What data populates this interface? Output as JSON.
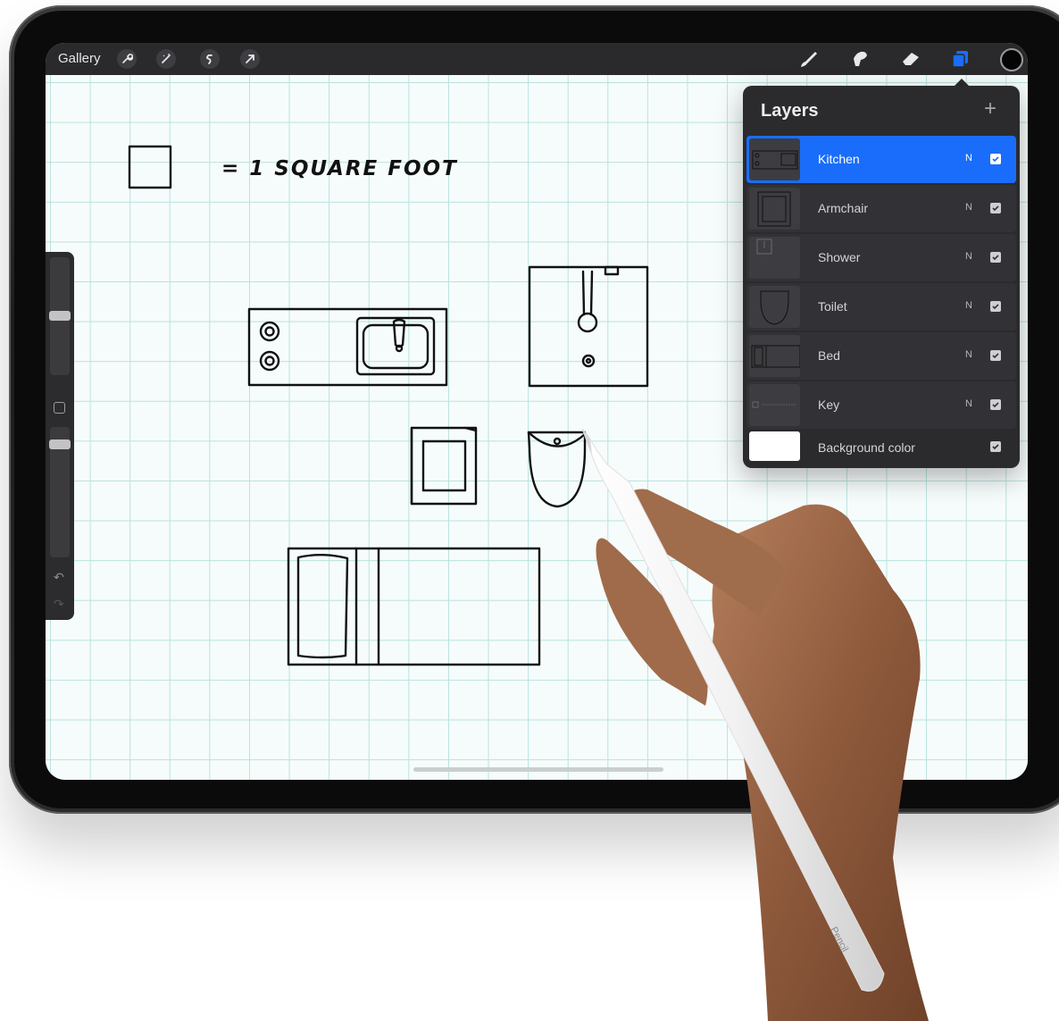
{
  "toolbar": {
    "gallery_label": "Gallery",
    "left_tools": [
      "wrench-icon",
      "magic-wand-icon",
      "selection-icon",
      "transform-arrow-icon"
    ],
    "right_tools": [
      "brush-icon",
      "smudge-icon",
      "eraser-icon",
      "layers-icon"
    ],
    "active_tool": "layers-icon",
    "current_color": "#050505"
  },
  "canvas": {
    "key_text": "= 1 SQUARE FOOT",
    "grid_color": "#b7e3df",
    "ink_color": "#111111"
  },
  "layers_panel": {
    "title": "Layers",
    "add_label": "+",
    "layers": [
      {
        "name": "Kitchen",
        "blend": "N",
        "visible": true,
        "active": true
      },
      {
        "name": "Armchair",
        "blend": "N",
        "visible": true,
        "active": false
      },
      {
        "name": "Shower",
        "blend": "N",
        "visible": true,
        "active": false
      },
      {
        "name": "Toilet",
        "blend": "N",
        "visible": true,
        "active": false
      },
      {
        "name": "Bed",
        "blend": "N",
        "visible": true,
        "active": false
      },
      {
        "name": "Key",
        "blend": "N",
        "visible": true,
        "active": false
      },
      {
        "name": "Background color",
        "blend": "",
        "visible": true,
        "active": false
      }
    ],
    "accent_color": "#1a6dfa"
  },
  "pencil": {
    "brand_text": "Pencil"
  }
}
